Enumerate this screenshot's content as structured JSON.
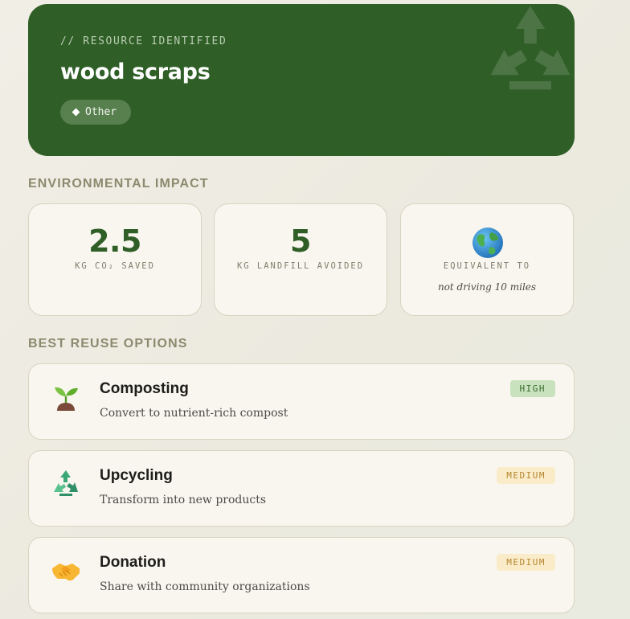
{
  "hero": {
    "eyebrow": "// RESOURCE IDENTIFIED",
    "title": "wood scraps",
    "category": "Other",
    "watermark_icon": "recycle-icon"
  },
  "impact": {
    "section_title": "ENVIRONMENTAL IMPACT",
    "co2": {
      "value": "2.5",
      "label": "KG CO₂ SAVED"
    },
    "landfill": {
      "value": "5",
      "label": "KG LANDFILL AVOIDED"
    },
    "equivalent": {
      "icon": "globe-icon",
      "label": "EQUIVALENT TO",
      "text": "not driving 10 miles"
    }
  },
  "reuse": {
    "section_title": "BEST REUSE OPTIONS",
    "options": [
      {
        "icon": "seedling-icon",
        "title": "Composting",
        "description": "Convert to nutrient-rich compost",
        "badge": "HIGH"
      },
      {
        "icon": "recycle-icon",
        "title": "Upcycling",
        "description": "Transform into new products",
        "badge": "MEDIUM"
      },
      {
        "icon": "handshake-icon",
        "title": "Donation",
        "description": "Share with community organizations",
        "badge": "MEDIUM"
      }
    ]
  },
  "colors": {
    "hero_bg": "#2f5e27",
    "accent_green": "#2f5e27",
    "badge_high_bg": "#c7e2bd",
    "badge_medium_bg": "#fbecc9",
    "card_bg": "#f9f6ef"
  }
}
